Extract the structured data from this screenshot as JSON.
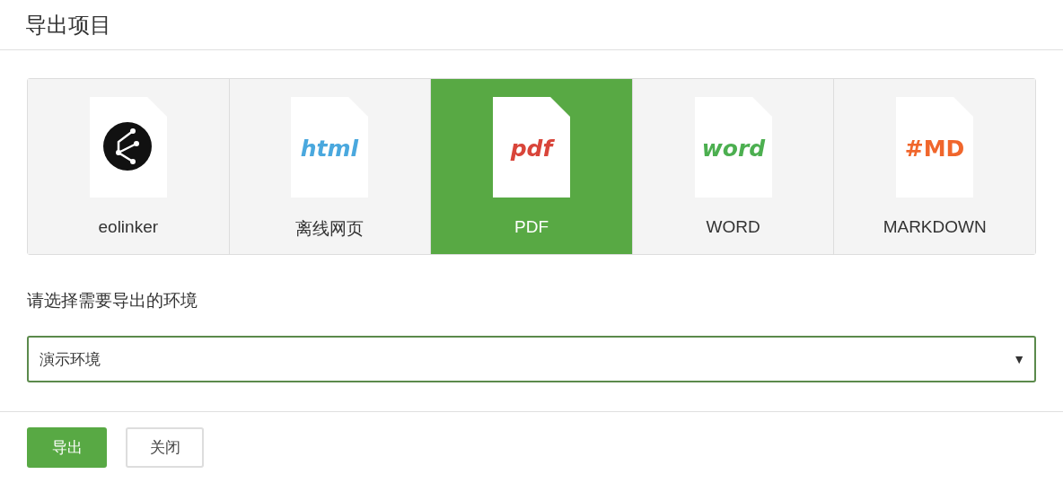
{
  "dialog": {
    "title": "导出项目"
  },
  "formats": [
    {
      "label": "eolinker",
      "kind": "logo",
      "selected": false
    },
    {
      "label": "离线网页",
      "kind": "text",
      "icon_text": "html",
      "color": "#4aa8de",
      "selected": false
    },
    {
      "label": "PDF",
      "kind": "text",
      "icon_text": "pdf",
      "color": "#d9453a",
      "selected": true
    },
    {
      "label": "WORD",
      "kind": "text",
      "icon_text": "word",
      "color": "#4caf50",
      "selected": false
    },
    {
      "label": "MARKDOWN",
      "kind": "text",
      "icon_text": "#MD",
      "color": "#f0662c",
      "selected": false
    }
  ],
  "environment": {
    "label": "请选择需要导出的环境",
    "value": "演示环境",
    "arrow": "▼"
  },
  "buttons": [
    {
      "label": "导出",
      "kind": "primary"
    },
    {
      "label": "关闭",
      "kind": "default"
    }
  ]
}
